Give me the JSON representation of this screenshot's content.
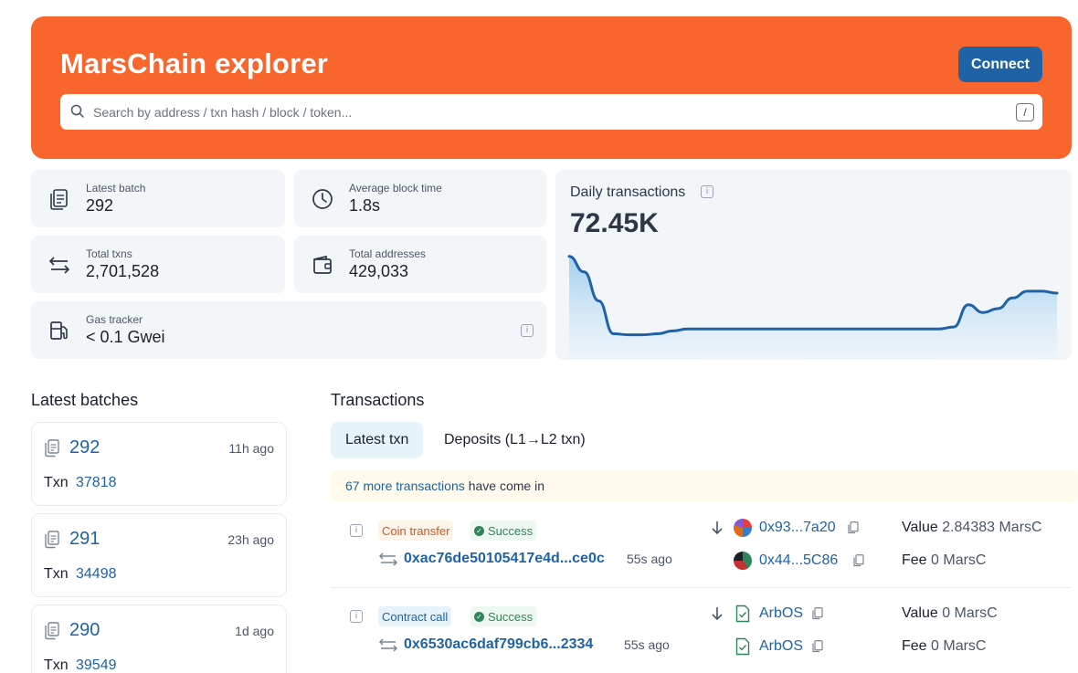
{
  "header": {
    "title": "MarsChain explorer",
    "connect_label": "Connect",
    "search_placeholder": "Search by address / txn hash / block / token...",
    "search_shortcut": "/",
    "brand_color": "#f8652d"
  },
  "stats": {
    "latest_batch": {
      "label": "Latest batch",
      "value": "292"
    },
    "avg_block_time": {
      "label": "Average block time",
      "value": "1.8s"
    },
    "total_txns": {
      "label": "Total txns",
      "value": "2,701,528"
    },
    "total_addresses": {
      "label": "Total addresses",
      "value": "429,033"
    },
    "gas_tracker": {
      "label": "Gas tracker",
      "value": "< 0.1 Gwei"
    }
  },
  "daily_chart": {
    "title": "Daily transactions",
    "value": "72.45K"
  },
  "chart_data": {
    "type": "area",
    "title": "Daily transactions",
    "xlabel": "",
    "ylabel": "",
    "grid": false,
    "values": [
      88,
      72,
      42,
      8,
      7,
      7,
      8,
      11,
      13,
      13,
      13,
      13,
      13,
      13,
      13,
      13,
      13,
      13,
      13,
      13,
      13,
      13,
      13,
      13,
      13,
      13,
      15,
      38,
      30,
      34,
      45,
      52,
      52,
      50
    ]
  },
  "batches": {
    "title": "Latest batches",
    "txn_label": "Txn",
    "items": [
      {
        "number": "292",
        "age": "11h ago",
        "txn": "37818"
      },
      {
        "number": "291",
        "age": "23h ago",
        "txn": "34498"
      },
      {
        "number": "290",
        "age": "1d ago",
        "txn": "39549"
      }
    ]
  },
  "transactions": {
    "title": "Transactions",
    "tabs": [
      {
        "label": "Latest txn"
      },
      {
        "label": "Deposits (L1→L2 txn)"
      }
    ],
    "notice_link": "67 more transactions",
    "notice_text": "have come in",
    "value_label": "Value",
    "fee_label": "Fee",
    "rows": [
      {
        "type": "Coin transfer",
        "status": "Success",
        "hash": "0xac76de50105417e4d...ce0c",
        "age": "55s ago",
        "from": "0x93...7a20",
        "to": "0x44...5C86",
        "value": "2.84383 MarsC",
        "fee": "0 MarsC"
      },
      {
        "type": "Contract call",
        "status": "Success",
        "hash": "0x6530ac6daf799cb6...2334",
        "age": "55s ago",
        "from": "ArbOS",
        "to": "ArbOS",
        "value": "0 MarsC",
        "fee": "0 MarsC"
      }
    ]
  }
}
